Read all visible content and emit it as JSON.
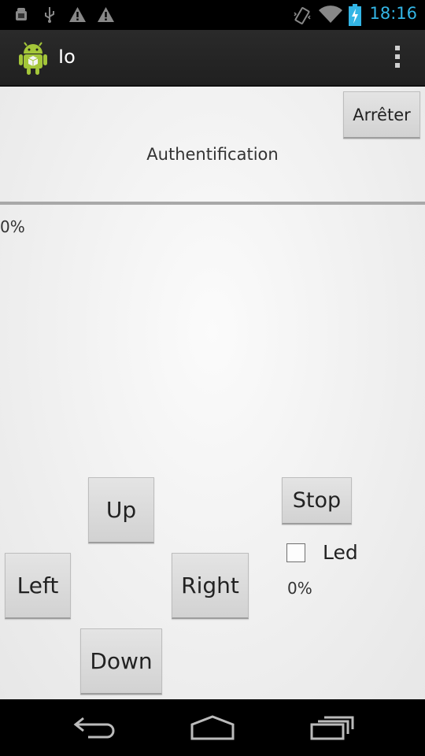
{
  "status_bar": {
    "time": "18:16",
    "time_color": "#33b5e5",
    "icons": [
      "android-debug-icon",
      "usb-icon",
      "warning-icon",
      "warning-icon",
      "vibrate-icon",
      "wifi-icon",
      "battery-charging-icon"
    ]
  },
  "action_bar": {
    "title": "Io",
    "app_icon": "android-icon",
    "overflow_icon": "overflow-menu-icon"
  },
  "content": {
    "stop_button_top": "Arrêter",
    "auth_label": "Authentification",
    "progress_top": "0%",
    "controls": {
      "up": "Up",
      "left": "Left",
      "right": "Right",
      "down": "Down",
      "stop": "Stop"
    },
    "led": {
      "label": "Led",
      "checked": false
    },
    "progress_bottom": "0%"
  },
  "nav_bar": {
    "back_icon": "back-icon",
    "home_icon": "home-icon",
    "recents_icon": "recent-apps-icon"
  }
}
